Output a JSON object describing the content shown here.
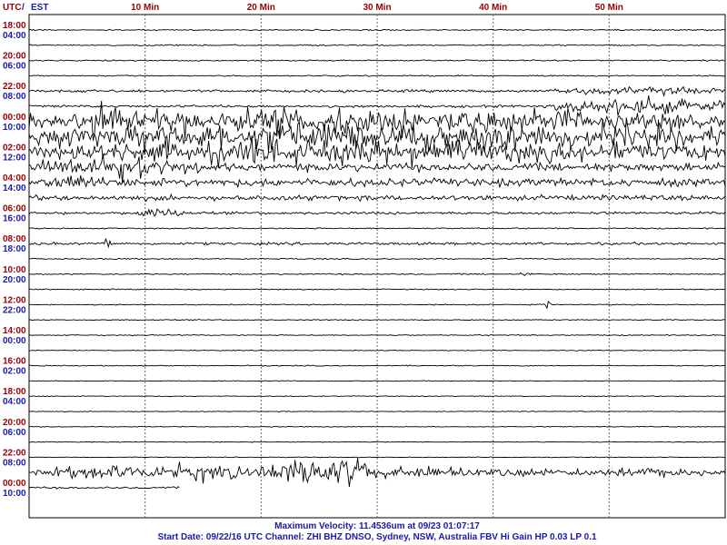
{
  "chart_data": {
    "type": "line",
    "title": "",
    "header_label": {
      "utc": "UTC",
      "separator": " / ",
      "local": "EST"
    },
    "x_ticks": [
      {
        "value": 10,
        "label": "10 Min"
      },
      {
        "value": 20,
        "label": "20 Min"
      },
      {
        "value": 30,
        "label": "30 Min"
      },
      {
        "value": 40,
        "label": "40 Min"
      },
      {
        "value": 50,
        "label": "50 Min"
      }
    ],
    "xlim": [
      0,
      60
    ],
    "rows_per_hour": 2,
    "hour_labels": [
      {
        "utc": "18:00",
        "local": "04:00"
      },
      {
        "utc": "20:00",
        "local": "06:00"
      },
      {
        "utc": "22:00",
        "local": "08:00"
      },
      {
        "utc": "00:00",
        "local": "10:00"
      },
      {
        "utc": "02:00",
        "local": "12:00"
      },
      {
        "utc": "04:00",
        "local": "14:00"
      },
      {
        "utc": "06:00",
        "local": "16:00"
      },
      {
        "utc": "08:00",
        "local": "18:00"
      },
      {
        "utc": "10:00",
        "local": "20:00"
      },
      {
        "utc": "12:00",
        "local": "22:00"
      },
      {
        "utc": "14:00",
        "local": "00:00"
      },
      {
        "utc": "16:00",
        "local": "02:00"
      },
      {
        "utc": "18:00",
        "local": "04:00"
      },
      {
        "utc": "20:00",
        "local": "06:00"
      },
      {
        "utc": "22:00",
        "local": "08:00"
      },
      {
        "utc": "00:00",
        "local": "10:00"
      }
    ],
    "trace_count": 31,
    "trace_end_minute": 10,
    "activity": {
      "background_amplitude": [
        1,
        1,
        1,
        1,
        2,
        2,
        4,
        9,
        9,
        6,
        6,
        4,
        2,
        1,
        2,
        1,
        1,
        0.8,
        0.8,
        0.8,
        0.8,
        0.6,
        0.8,
        0.6,
        0.6,
        0.6,
        0.6,
        0.6,
        0.6,
        4,
        1.5
      ],
      "events": [
        {
          "trace": 4,
          "start": 45,
          "end": 60,
          "amplitude": 6
        },
        {
          "trace": 5,
          "start": 45,
          "end": 60,
          "amplitude": 12
        },
        {
          "trace": 6,
          "start": 0,
          "end": 60,
          "amplitude": 20
        },
        {
          "trace": 6,
          "start": 5,
          "end": 8,
          "amplitude": 30
        },
        {
          "trace": 7,
          "start": 0,
          "end": 60,
          "amplitude": 22
        },
        {
          "trace": 8,
          "start": 0,
          "end": 60,
          "amplitude": 18
        },
        {
          "trace": 9,
          "start": 0,
          "end": 15,
          "amplitude": 16
        },
        {
          "trace": 10,
          "start": 0,
          "end": 8,
          "amplitude": 10
        },
        {
          "trace": 12,
          "start": 9,
          "end": 13.5,
          "amplitude": 9
        },
        {
          "trace": 14,
          "start": 6.5,
          "end": 7.2,
          "amplitude": 9
        },
        {
          "trace": 16,
          "start": 42,
          "end": 43.5,
          "amplitude": 3
        },
        {
          "trace": 18,
          "start": 44,
          "end": 45,
          "amplitude": 5
        },
        {
          "trace": 29,
          "start": 2,
          "end": 20,
          "amplitude": 12
        },
        {
          "trace": 29,
          "start": 20,
          "end": 30,
          "amplitude": 22
        },
        {
          "trace": 29,
          "start": 30,
          "end": 45,
          "amplitude": 10
        },
        {
          "trace": 29,
          "start": 45,
          "end": 60,
          "amplitude": 6
        },
        {
          "trace": 30,
          "start": 20,
          "end": 26,
          "amplitude": 18
        }
      ]
    },
    "colors": {
      "trace": "#000000",
      "gridline": "#000000",
      "minute_line": "#666666",
      "utc_label": "#990000",
      "local_label": "#1a1aaa",
      "footer": "#1a1aaa"
    },
    "footer": {
      "line1": "Maximum Velocity: 11.4536um at 09/23 01:07:17",
      "line2": "Start Date: 09/22/16 UTC Channel: ZHI  BHZ  DNSO, Sydney, NSW, Australia  FBV Hi Gain HP 0.03  LP 0.1"
    }
  }
}
